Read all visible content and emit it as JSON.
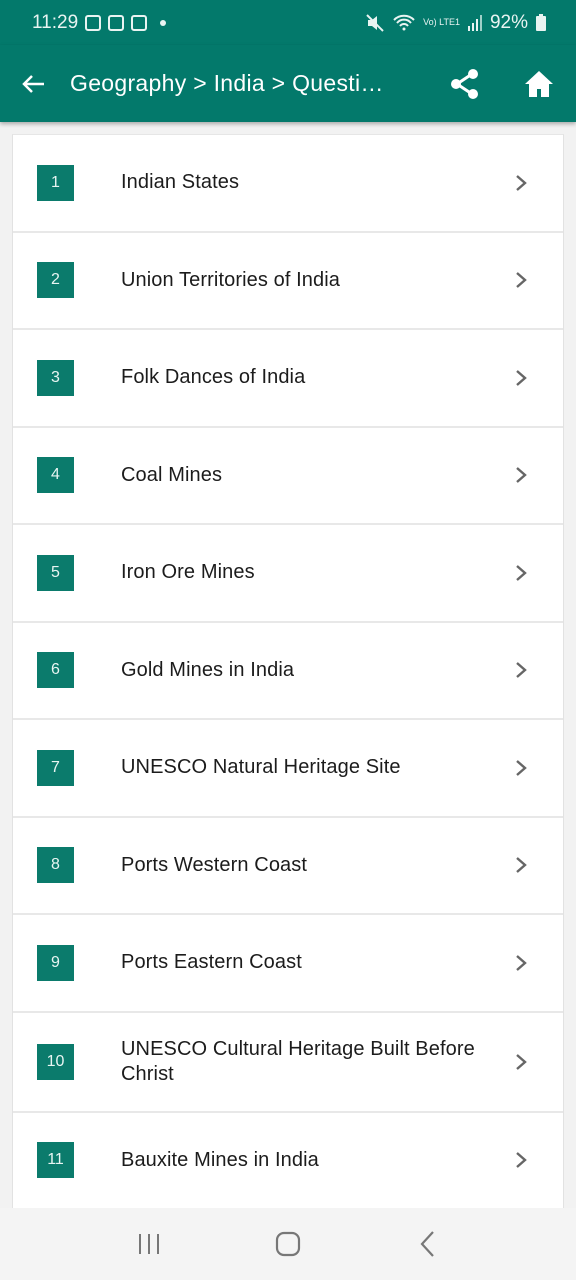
{
  "status_bar": {
    "time": "11:29",
    "battery": "92%",
    "network_label": "Vo) LTE1"
  },
  "app_bar": {
    "title": "Geography > India > Questi…",
    "icons": {
      "back": "arrow-left-icon",
      "share": "share-icon",
      "home": "home-icon"
    }
  },
  "colors": {
    "primary": "#03796b",
    "badge": "#0b7b6c"
  },
  "list": {
    "items": [
      {
        "number": "1",
        "label": "Indian States"
      },
      {
        "number": "2",
        "label": "Union Territories of India"
      },
      {
        "number": "3",
        "label": "Folk Dances of India"
      },
      {
        "number": "4",
        "label": "Coal Mines"
      },
      {
        "number": "5",
        "label": "Iron Ore Mines"
      },
      {
        "number": "6",
        "label": "Gold Mines in India"
      },
      {
        "number": "7",
        "label": "UNESCO Natural Heritage Site"
      },
      {
        "number": "8",
        "label": "Ports Western Coast"
      },
      {
        "number": "9",
        "label": "Ports Eastern Coast"
      },
      {
        "number": "10",
        "label": "UNESCO Cultural Heritage Built Before Christ"
      },
      {
        "number": "11",
        "label": "Bauxite Mines in India"
      }
    ]
  },
  "nav_bar": {
    "icons": [
      "recent-apps-icon",
      "home-circle-icon",
      "back-chevron-icon"
    ]
  }
}
